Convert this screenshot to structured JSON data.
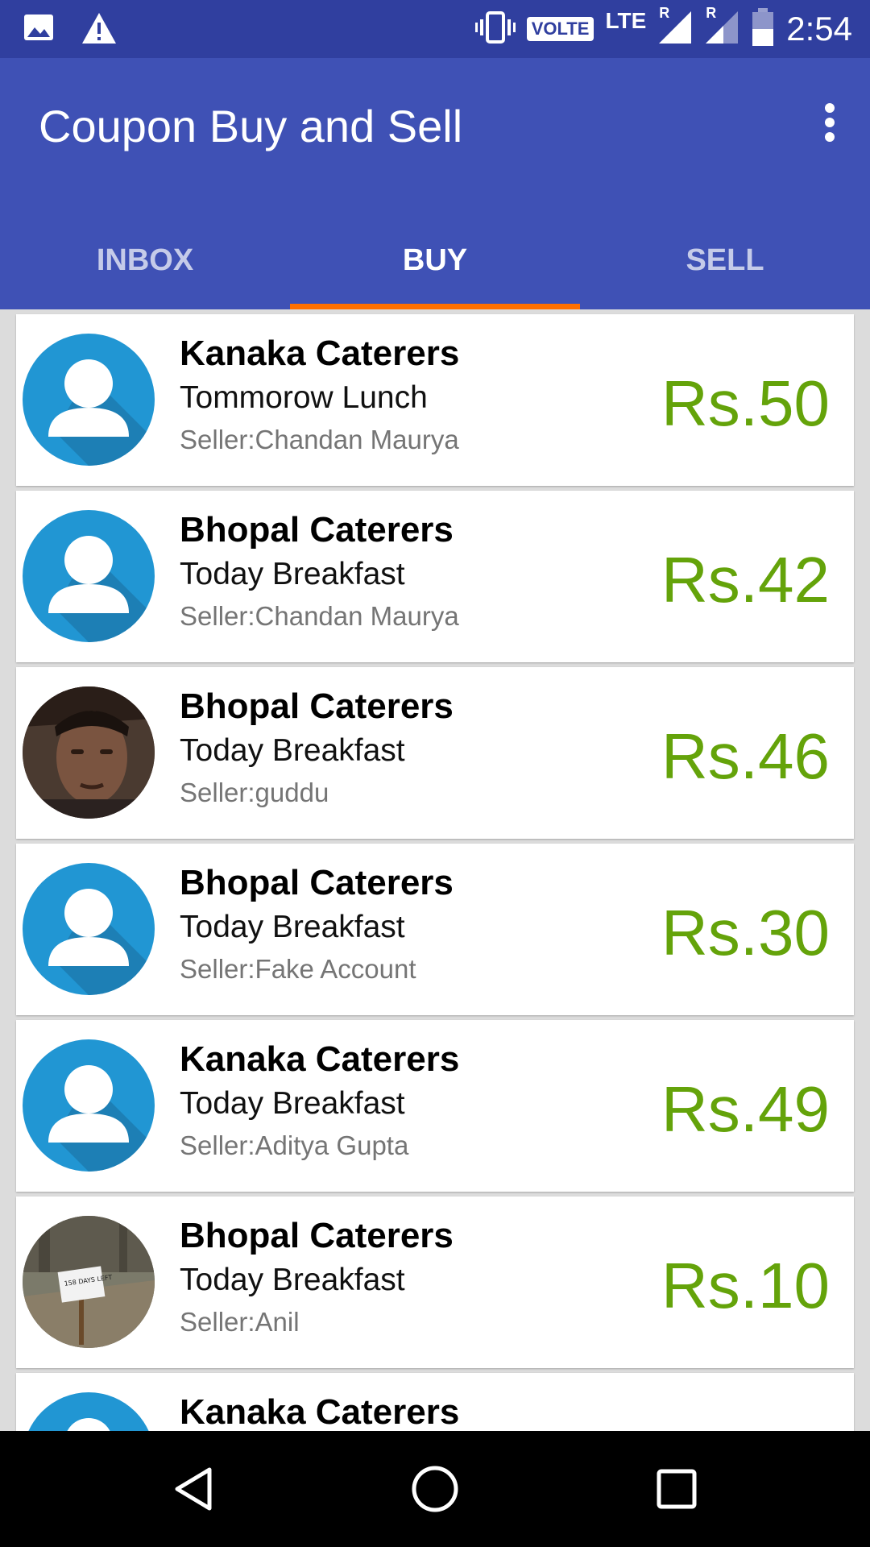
{
  "status_bar": {
    "time": "2:54",
    "volte": "VOLTE",
    "lte": "LTE",
    "roaming_1": "R",
    "roaming_2": "R",
    "icons": [
      "image-icon",
      "warning-icon",
      "vibrate-icon",
      "signal-icon",
      "battery-icon"
    ]
  },
  "app_bar": {
    "title": "Coupon Buy and Sell",
    "menu_icon": "more-vert-icon"
  },
  "tabs": [
    {
      "label": "INBOX",
      "active": false
    },
    {
      "label": "BUY",
      "active": true
    },
    {
      "label": "SELL",
      "active": false
    }
  ],
  "colors": {
    "primary": "#3f51b5",
    "primary_dark": "#303f9f",
    "tab_indicator": "#ff6f00",
    "price": "#64a30a",
    "avatar_blue": "#2196d3"
  },
  "listings": [
    {
      "caterer": "Kanaka Caterers",
      "meal": "Tommorow Lunch",
      "seller": "Seller:Chandan Maurya",
      "price": "Rs.50",
      "avatar": "default-person-icon"
    },
    {
      "caterer": "Bhopal Caterers",
      "meal": "Today Breakfast",
      "seller": "Seller:Chandan Maurya",
      "price": "Rs.42",
      "avatar": "default-person-icon"
    },
    {
      "caterer": "Bhopal Caterers",
      "meal": "Today Breakfast",
      "seller": "Seller:guddu",
      "price": "Rs.46",
      "avatar": "user-photo"
    },
    {
      "caterer": "Bhopal Caterers",
      "meal": "Today Breakfast",
      "seller": "Seller:Fake Account",
      "price": "Rs.30",
      "avatar": "default-person-icon"
    },
    {
      "caterer": "Kanaka Caterers",
      "meal": "Today Breakfast",
      "seller": "Seller:Aditya Gupta",
      "price": "Rs.49",
      "avatar": "default-person-icon"
    },
    {
      "caterer": "Bhopal Caterers",
      "meal": "Today Breakfast",
      "seller": "Seller:Anil",
      "price": "Rs.10",
      "avatar": "user-photo"
    },
    {
      "caterer": "Kanaka Caterers",
      "meal": "",
      "seller": "",
      "price": "",
      "avatar": "default-person-icon"
    }
  ],
  "photo_caption": "158 DAYS LEFT",
  "nav_bar": {
    "icons": [
      "back-icon",
      "home-icon",
      "recents-icon"
    ]
  }
}
